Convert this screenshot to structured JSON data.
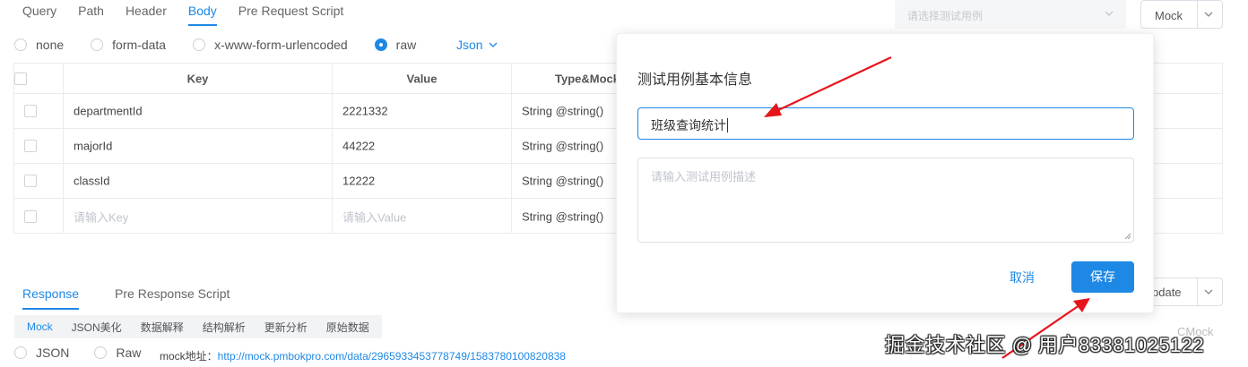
{
  "request_tabs": [
    {
      "label": "Query",
      "active": false
    },
    {
      "label": "Path",
      "active": false
    },
    {
      "label": "Header",
      "active": false
    },
    {
      "label": "Body",
      "active": true
    },
    {
      "label": "Pre Request Script",
      "active": false
    }
  ],
  "test_case_select": {
    "placeholder": "请选择测试用例"
  },
  "mock_select": {
    "value": "Mock"
  },
  "body_types": [
    {
      "label": "none",
      "checked": false
    },
    {
      "label": "form-data",
      "checked": false
    },
    {
      "label": "x-www-form-urlencoded",
      "checked": false
    },
    {
      "label": "raw",
      "checked": true
    }
  ],
  "raw_format": "Json",
  "params_table": {
    "headers": [
      "Key",
      "Value",
      "Type&Mock"
    ],
    "rows": [
      {
        "key": "departmentId",
        "value": "2221332",
        "type": "String @string()"
      },
      {
        "key": "majorId",
        "value": "44222",
        "type": "String @string()"
      },
      {
        "key": "classId",
        "value": "12222",
        "type": "String @string()"
      }
    ],
    "new_row": {
      "key_placeholder": "请输入Key",
      "value_placeholder": "请输入Value",
      "type": "String @string()"
    }
  },
  "response_tabs": [
    {
      "label": "Response",
      "active": true
    },
    {
      "label": "Pre Response Script",
      "active": false
    }
  ],
  "response_subtabs": [
    {
      "label": "Mock",
      "active": true
    },
    {
      "label": "JSON美化",
      "active": false
    },
    {
      "label": "数据解释",
      "active": false
    },
    {
      "label": "结构解析",
      "active": false
    },
    {
      "label": "更新分析",
      "active": false
    },
    {
      "label": "原始数据",
      "active": false
    }
  ],
  "response_formats": [
    {
      "label": "JSON",
      "checked": false
    },
    {
      "label": "Raw",
      "checked": false
    }
  ],
  "mock_url": {
    "label": "mock地址：",
    "url": "http://mock.pmbokpro.com/data/2965933453778749/1583780100820838"
  },
  "update_select": {
    "value": "pdate"
  },
  "cmock_label": "CMock",
  "dialog": {
    "title": "测试用例基本信息",
    "name_value": "班级查询统计",
    "description_placeholder": "请输入测试用例描述",
    "cancel_label": "取消",
    "save_label": "保存"
  },
  "watermark": "掘金技术社区 @ 用户83381025122",
  "colors": {
    "accent": "#1e88e5",
    "annotation": "#e8141b"
  }
}
